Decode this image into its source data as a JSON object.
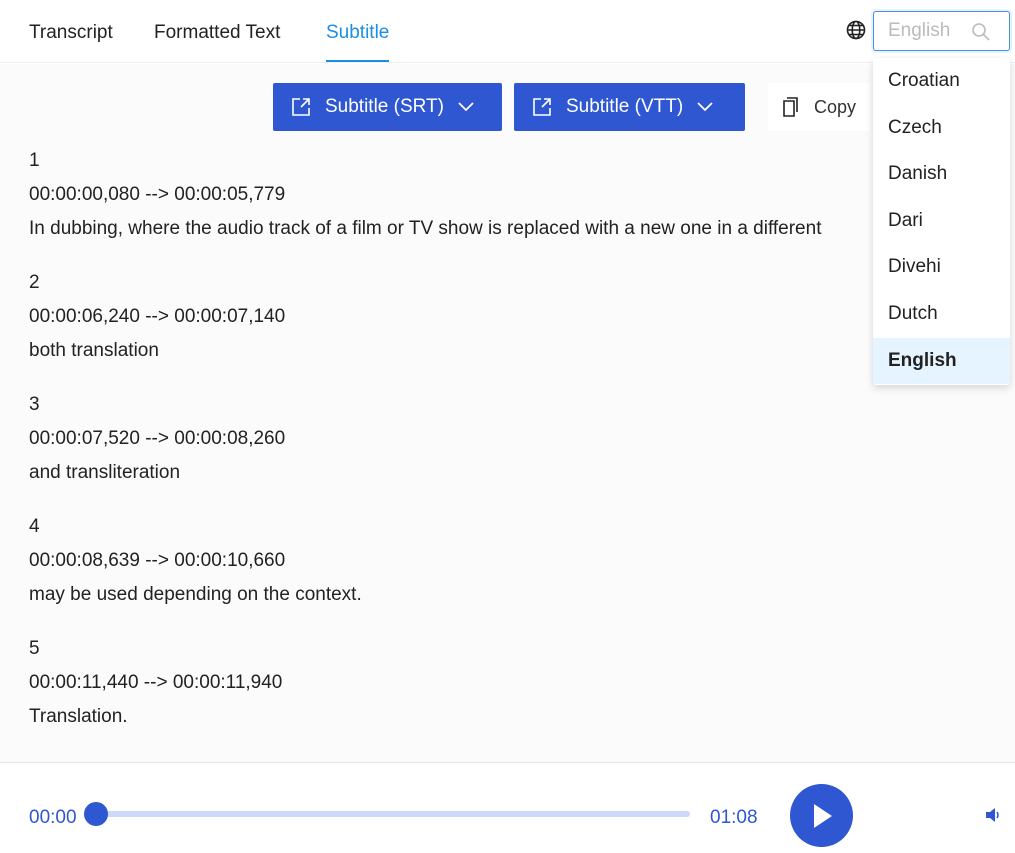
{
  "tabs": [
    {
      "label": "Transcript"
    },
    {
      "label": "Formatted Text"
    },
    {
      "label": "Subtitle",
      "active": true
    }
  ],
  "toolbar": {
    "srt_label": "Subtitle (SRT)",
    "vtt_label": "Subtitle (VTT)",
    "copy_label": "Copy"
  },
  "language": {
    "placeholder": "English",
    "options": [
      "Croatian",
      "Czech",
      "Danish",
      "Dari",
      "Divehi",
      "Dutch",
      "English"
    ],
    "selected": "English"
  },
  "entries": [
    {
      "index": "1",
      "time": "00:00:00,080 --> 00:00:05,779",
      "text": "In dubbing, where the audio track of a film or TV show is replaced with a new one in a different"
    },
    {
      "index": "2",
      "time": "00:00:06,240 --> 00:00:07,140",
      "text": "both translation"
    },
    {
      "index": "3",
      "time": "00:00:07,520 --> 00:00:08,260",
      "text": "and transliteration"
    },
    {
      "index": "4",
      "time": "00:00:08,639 --> 00:00:10,660",
      "text": "may be used depending on the context."
    },
    {
      "index": "5",
      "time": "00:00:11,440 --> 00:00:11,940",
      "text": "Translation."
    },
    {
      "index": "6",
      "time": "",
      "text": ""
    }
  ],
  "player": {
    "current": "00:00",
    "duration": "01:08",
    "progress": 0
  },
  "colors": {
    "accent": "#2e57d1",
    "tab_active": "#1a8fe3"
  }
}
